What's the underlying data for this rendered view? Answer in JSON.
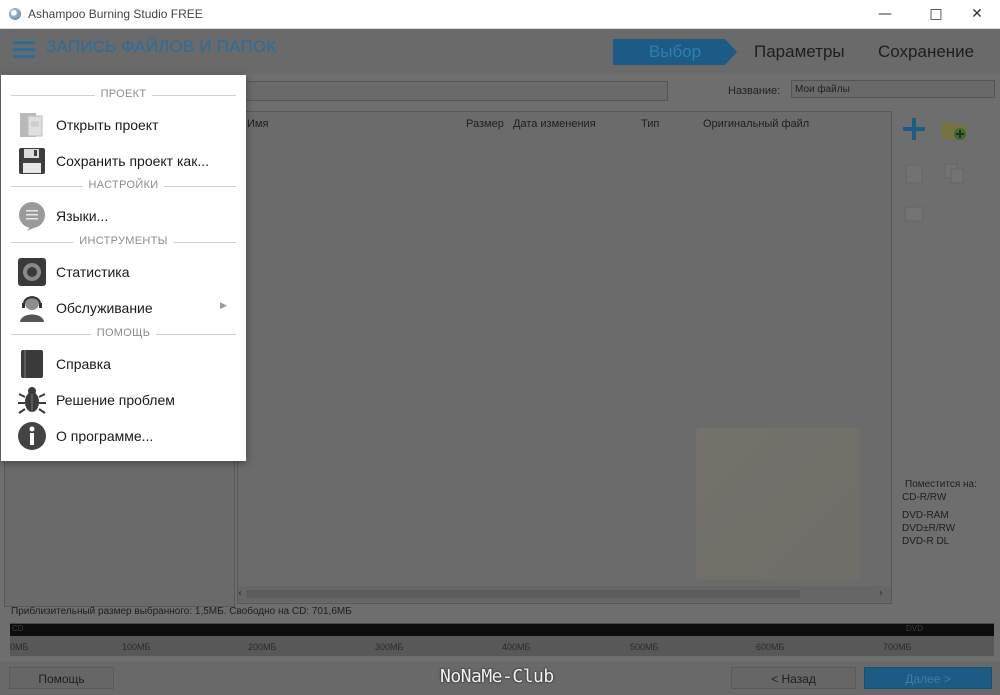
{
  "window": {
    "title": "Ashampoo Burning Studio FREE"
  },
  "header": {
    "title": "ЗАПИСЬ ФАЙЛОВ И ПАПОК",
    "steps": [
      "Выбор",
      "Параметры",
      "Сохранение"
    ]
  },
  "toprow": {
    "name_label": "Название:",
    "name_value": "Мои файлы"
  },
  "columns": [
    "Имя",
    "Размер",
    "Дата изменения",
    "Тип",
    "Оригинальный файл"
  ],
  "fits": {
    "title": "Поместится на:",
    "media": [
      "CD-R/RW",
      "DVD-RAM",
      "DVD±R/RW",
      "DVD-R DL"
    ]
  },
  "status": {
    "size_line": "Приблизительный размер выбранного: 1,5МБ. Свободно на CD: 701,6МБ",
    "bar_cd": "CD",
    "bar_dvd": "DVD",
    "ruler": [
      "0МБ",
      "100МБ",
      "200МБ",
      "300МБ",
      "400МБ",
      "500МБ",
      "600МБ",
      "700МБ"
    ]
  },
  "bottom": {
    "help": "Помощь",
    "back": "< Назад",
    "next": "Далее >",
    "brand": "NoNaMe-Club"
  },
  "menu": {
    "sections": [
      "ПРОЕКТ",
      "НАСТРОЙКИ",
      "ИНСТРУМЕНТЫ",
      "ПОМОЩЬ"
    ],
    "items": [
      {
        "label": "Открыть проект",
        "icon": "open-project-icon"
      },
      {
        "label": "Сохранить проект как...",
        "icon": "floppy-icon"
      },
      {
        "label": "Языки...",
        "icon": "speech-bubble-icon"
      },
      {
        "label": "Статистика",
        "icon": "statistics-icon"
      },
      {
        "label": "Обслуживание",
        "icon": "support-agent-icon"
      },
      {
        "label": "Справка",
        "icon": "help-book-icon"
      },
      {
        "label": "Решение проблем",
        "icon": "bug-icon"
      },
      {
        "label": "О программе...",
        "icon": "info-icon"
      }
    ]
  },
  "colors": {
    "accent": "#1b5b86",
    "overlay": "#6e6e6e"
  }
}
